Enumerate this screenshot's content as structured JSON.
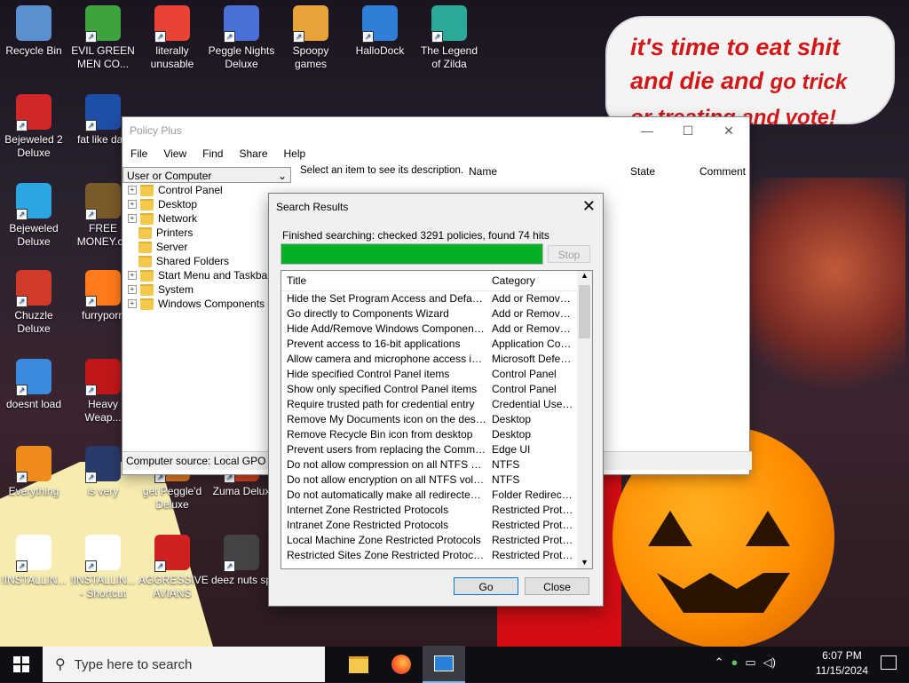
{
  "wallpaper_text": {
    "line1": "it's time to eat shit",
    "line2a": "and die and ",
    "line2b": "go trick",
    "line3": "or treating and vote!"
  },
  "desktop_icons": [
    {
      "label": "Recycle Bin",
      "color": "#5a8fd0"
    },
    {
      "label": "EVIL GREEN MEN CO...",
      "color": "#3da33d"
    },
    {
      "label": "literally unusable",
      "color": "#e84335"
    },
    {
      "label": "Peggle Nights Deluxe",
      "color": "#4a6fd6"
    },
    {
      "label": "Spoopy games",
      "color": "#e8a23a"
    },
    {
      "label": "HalloDock",
      "color": "#2f7fd8"
    },
    {
      "label": "The Legend of Zilda",
      "color": "#2aa898"
    },
    {
      "label": "Bejeweled 2 Deluxe",
      "color": "#d02828"
    },
    {
      "label": "fat like darl",
      "color": "#1f4ea8"
    },
    {
      "label": "Bejeweled Deluxe",
      "color": "#2ba6e0"
    },
    {
      "label": "FREE MONEY.co",
      "color": "#7a5a2a"
    },
    {
      "label": "Chuzzle Deluxe",
      "color": "#d23a2a"
    },
    {
      "label": "furryporn",
      "color": "#ff7a1a"
    },
    {
      "label": "doesnt load",
      "color": "#3a8ae0"
    },
    {
      "label": "Heavy Weap...",
      "color": "#c01818"
    },
    {
      "label": "Everything",
      "color": "#f08a1a"
    },
    {
      "label": "is very",
      "color": "#2a3a6a"
    },
    {
      "label": "get Peggle'd Deluxe",
      "color": "#e07a20"
    },
    {
      "label": "Zuma Delux",
      "color": "#d04020"
    },
    {
      "label": "!INSTALLIN...",
      "color": "#ffffff"
    },
    {
      "label": "!INSTALLIN... - Shortcut",
      "color": "#ffffff"
    },
    {
      "label": "AGGRESSIVE AVIANS",
      "color": "#d02020"
    },
    {
      "label": "deez nuts sp",
      "color": "#444444"
    }
  ],
  "policy_window": {
    "title": "Policy Plus",
    "menu": [
      "File",
      "View",
      "Find",
      "Share",
      "Help"
    ],
    "combo": "User or Computer",
    "tree": [
      "Control Panel",
      "Desktop",
      "Network",
      "Printers",
      "Server",
      "Shared Folders",
      "Start Menu and Taskbar",
      "System",
      "Windows Components"
    ],
    "tree_expandable": [
      true,
      true,
      true,
      false,
      false,
      false,
      true,
      true,
      true
    ],
    "description": "Select an item to see its description.",
    "columns": [
      "Name",
      "State",
      "Comment"
    ],
    "status": "Computer source:  Local GPO"
  },
  "search_dialog": {
    "title": "Search Results",
    "close": "✕",
    "status": "Finished searching: checked 3291 policies, found 74 hits",
    "progress_percent": 100,
    "stop_label": "Stop",
    "columns": [
      "Title",
      "Category"
    ],
    "rows": [
      [
        "Hide the Set Program Access and Defaults p...",
        "Add or Remove ..."
      ],
      [
        "Go directly to Components Wizard",
        "Add or Remove ..."
      ],
      [
        "Hide Add/Remove Windows Components pa...",
        "Add or Remove ..."
      ],
      [
        "Prevent access to 16-bit applications",
        "Application Com..."
      ],
      [
        "Allow camera and microphone access in Micr...",
        "Microsoft Defen..."
      ],
      [
        "Hide specified Control Panel items",
        "Control Panel"
      ],
      [
        "Show only specified Control Panel items",
        "Control Panel"
      ],
      [
        "Require trusted path for credential entry",
        "Credential User I..."
      ],
      [
        "Remove My Documents icon on the desktop",
        "Desktop"
      ],
      [
        "Remove Recycle Bin icon from desktop",
        "Desktop"
      ],
      [
        "Prevent users from replacing the Command P...",
        "Edge UI"
      ],
      [
        "Do not allow compression on all NTFS volumes",
        "NTFS"
      ],
      [
        "Do not allow encryption on all NTFS volumes",
        "NTFS"
      ],
      [
        "Do not automatically make all redirected folde...",
        "Folder Redirection"
      ],
      [
        "Internet Zone Restricted Protocols",
        "Restricted Proto..."
      ],
      [
        "Intranet Zone Restricted Protocols",
        "Restricted Proto..."
      ],
      [
        "Local Machine Zone Restricted Protocols",
        "Restricted Proto..."
      ],
      [
        "Restricted Sites Zone Restricted Protocols",
        "Restricted Proto..."
      ]
    ],
    "go_label": "Go",
    "close_label": "Close"
  },
  "taskbar": {
    "search_placeholder": "Type here to search",
    "time": "6:07 PM",
    "date": "11/15/2024"
  }
}
